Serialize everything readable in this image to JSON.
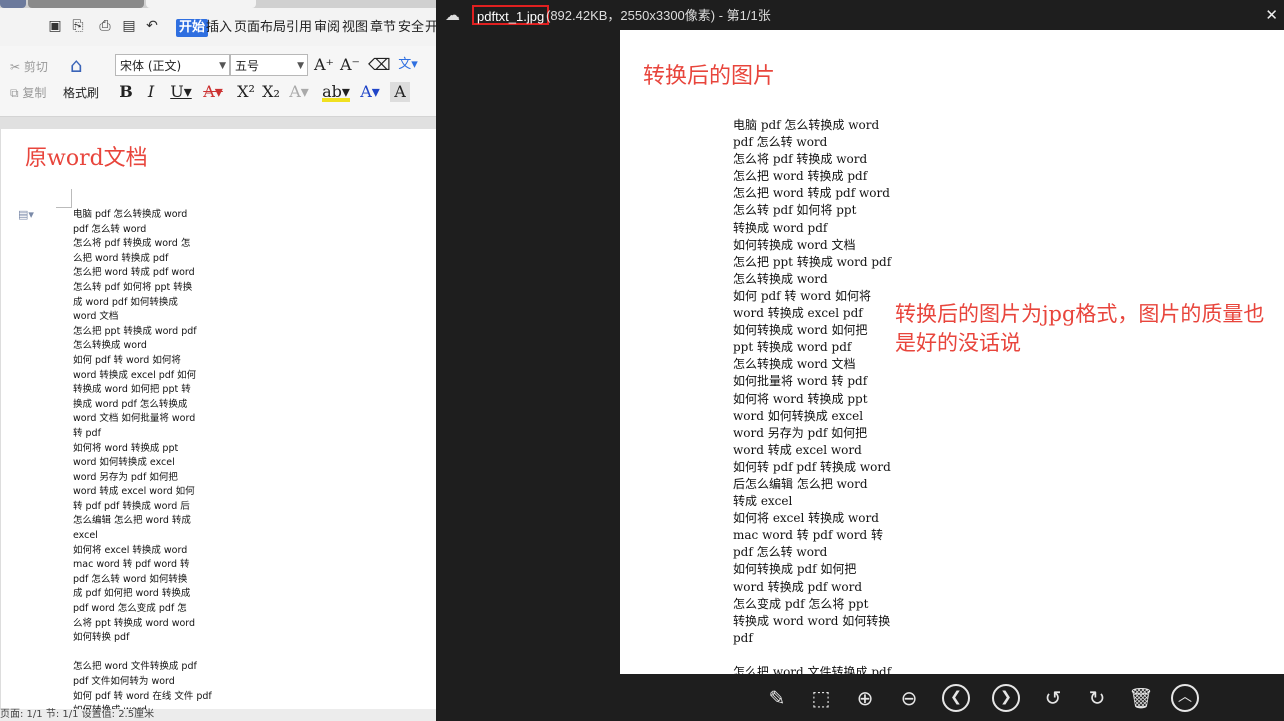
{
  "wps": {
    "menu": [
      "开始",
      "插入",
      "页面布局",
      "引用",
      "审阅",
      "视图",
      "章节",
      "安全",
      "开"
    ],
    "ribbon": {
      "cut": "剪切",
      "copy": "复制",
      "format_painter": "格式刷",
      "font_name": "宋体 (正文)",
      "font_size": "五号"
    },
    "doc_heading": "原word文档",
    "doc_lines": [
      "电脑 pdf 怎么转换成 word",
      "pdf 怎么转 word",
      "怎么将 pdf 转换成 word 怎",
      "么把 word 转换成 pdf",
      "怎么把 word 转成 pdf word",
      "怎么转 pdf 如何将 ppt 转换",
      "成 word pdf 如何转换成",
      "word 文档",
      "怎么把 ppt 转换成 word pdf",
      "怎么转换成 word",
      "如何 pdf 转 word 如何将",
      "word 转换成 excel pdf 如何",
      "转换成 word 如何把 ppt 转",
      "换成 word pdf 怎么转换成",
      "word 文档 如何批量将 word",
      "转 pdf",
      "如何将 word 转换成 ppt",
      "word 如何转换成 excel",
      "word 另存为 pdf 如何把",
      "word 转成 excel word 如何",
      "转 pdf pdf 转换成 word 后",
      "怎么编辑 怎么把 word 转成",
      "excel",
      "如何将 excel 转换成 word",
      "mac word 转 pdf word 转",
      "pdf 怎么转 word 如何转换",
      "成 pdf 如何把 word 转换成",
      "pdf word 怎么变成 pdf 怎",
      "么将 ppt 转换成 word word",
      "如何转换 pdf",
      "",
      "怎么把 word 文件转换成 pdf",
      "pdf 文件如何转为 word",
      "如何 pdf 转 word 在线 文件 pdf",
      "如何转换成 word"
    ],
    "status": "页面: 1/1   节: 1/1   设置值: 2.5厘米"
  },
  "viewer": {
    "filename": "pdftxt_1.jpg",
    "fileinfo": "(892.42KB，2550x3300像素) - 第1/1张",
    "image": {
      "heading": "转换后的图片",
      "lines": [
        "电脑 pdf 怎么转换成 word",
        "pdf 怎么转 word",
        "怎么将 pdf 转换成 word",
        "怎么把 word 转换成 pdf",
        "怎么把 word 转成 pdf word",
        "怎么转 pdf  如何将 ppt",
        "转换成 word pdf",
        "如何转换成 word 文档",
        "怎么把 ppt 转换成 word pdf",
        "怎么转换成 word",
        "如何 pdf 转 word  如何将",
        "word 转换成 excel pdf",
        "如何转换成 word  如何把",
        "ppt 转换成 word pdf",
        "怎么转换成 word 文档",
        "如何批量将 word 转 pdf",
        "如何将 word 转换成 ppt",
        "word 如何转换成 excel",
        "word 另存为 pdf  如何把",
        "word 转成 excel word",
        "如何转 pdf pdf 转换成 word",
        "后怎么编辑  怎么把 word",
        "转成 excel",
        "如何将 excel 转换成 word",
        "mac word 转 pdf word 转",
        "pdf 怎么转 word",
        "如何转换成 pdf  如何把",
        "word 转换成 pdf word",
        "怎么变成 pdf  怎么将 ppt",
        "转换成 word word 如何转换",
        "pdf",
        "",
        "怎么把 word 文件转换成 pdf"
      ],
      "annotation": "转换后的图片为jpg格式，图片的质量也是好的没话说"
    }
  }
}
